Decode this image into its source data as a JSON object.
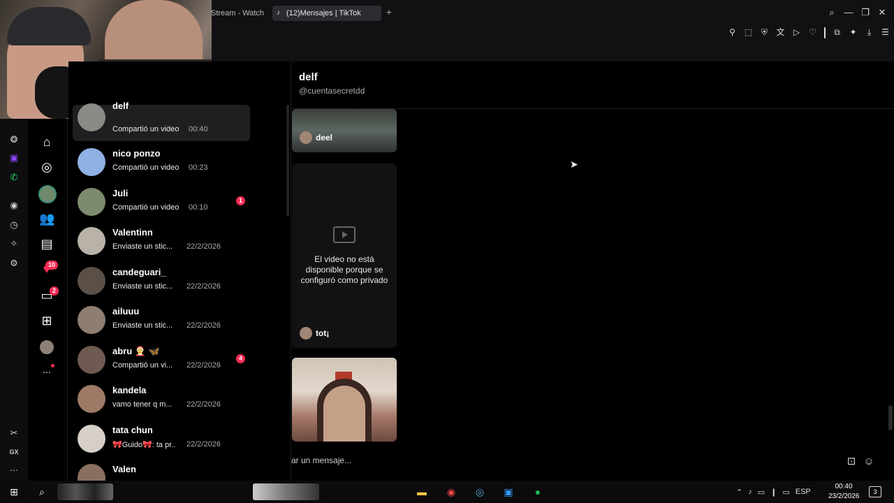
{
  "browser": {
    "tabs": [
      {
        "label": "Stream - Watch"
      },
      {
        "label": "(12)Mensajes | TikTok"
      }
    ],
    "new_tab": "+",
    "window_controls": {
      "minimize": "—",
      "restore": "❐",
      "close": "✕"
    }
  },
  "chat": {
    "name": "delf",
    "handle": "@cuentasecretdd",
    "messages": [
      {
        "sender": "deel"
      },
      {
        "sender": "tot¡",
        "unavailable_text": "El video no está disponible porque se configuró como privado"
      },
      {
        "sender": ""
      }
    ],
    "composer_placeholder": "ar un mensaje..."
  },
  "conversations": [
    {
      "name": "delf",
      "preview": "Compartió un video",
      "time": "00:40",
      "unread": ""
    },
    {
      "name": "nico ponzo",
      "preview": "Compartió un video",
      "time": "00:23",
      "unread": ""
    },
    {
      "name": "Juli",
      "preview": "Compartió un video",
      "time": "00:10",
      "unread": "1"
    },
    {
      "name": "Valentinn",
      "preview": "Enviaste un stic...",
      "time": "22/2/2026",
      "unread": ""
    },
    {
      "name": "candeguari_",
      "preview": "Enviaste un stic...",
      "time": "22/2/2026",
      "unread": ""
    },
    {
      "name": "ailuuu",
      "preview": "Enviaste un stic...",
      "time": "22/2/2026",
      "unread": ""
    },
    {
      "name": "abru 🤶 🦋",
      "preview": "Compartió un vi...",
      "time": "22/2/2026",
      "unread": "4"
    },
    {
      "name": "kandela",
      "preview": "vamo tener q m...",
      "time": "22/2/2026",
      "unread": ""
    },
    {
      "name": "tata chun",
      "preview": "🎀Guido🎀: ta pr...",
      "time": "22/2/2026",
      "unread": ""
    },
    {
      "name": "Valen",
      "preview": "",
      "time": "",
      "unread": ""
    }
  ],
  "nav": {
    "badges": {
      "activity": "10",
      "messages": "2"
    },
    "more": "..."
  },
  "opera_sidebar": {
    "gx_label": "GX",
    "more": "···"
  },
  "taskbar": {
    "language": "ESP",
    "time": "00:40",
    "date": "23/2/2026",
    "notifications": "3"
  },
  "colors": {
    "accent": "#fe2c55",
    "background": "#000000",
    "panel": "#111113"
  }
}
